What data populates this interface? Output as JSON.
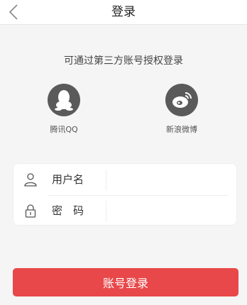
{
  "header": {
    "title": "登录",
    "back_icon": "chevron-left-icon"
  },
  "third_party": {
    "title": "可通过第三方账号授权登录",
    "providers": [
      {
        "label": "腾讯QQ",
        "icon": "qq-icon"
      },
      {
        "label": "新浪微博",
        "icon": "weibo-icon"
      }
    ]
  },
  "form": {
    "username": {
      "label": "用户名",
      "icon": "user-icon",
      "value": "",
      "placeholder": ""
    },
    "password": {
      "label": "密　码",
      "icon": "lock-icon",
      "value": "",
      "placeholder": ""
    }
  },
  "actions": {
    "login_label": "账号登录"
  },
  "colors": {
    "accent": "#e8484a",
    "background": "#f5f5f5",
    "icon_gray": "#5a5a5a"
  }
}
